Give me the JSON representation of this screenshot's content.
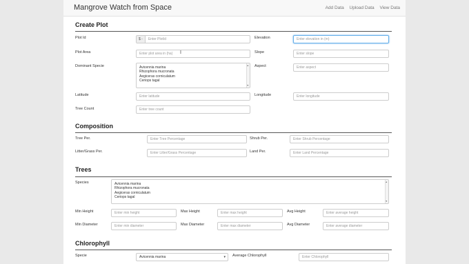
{
  "navbar": {
    "title": "Mangrove Watch from Space",
    "links": [
      "Add Data",
      "Upload Data",
      "View Data"
    ]
  },
  "create_plot": {
    "heading": "Create Plot",
    "plot_id": {
      "label": "Plot Id",
      "addon": "$ -",
      "placeholder": "Enter PlotId"
    },
    "elevation": {
      "label": "Elevation",
      "placeholder": "Enter elevation in (m)"
    },
    "plot_area": {
      "label": "Plot Area",
      "placeholder": "Enter plot area in (ha)"
    },
    "slope": {
      "label": "Slope",
      "placeholder": "Enter slope"
    },
    "dominant_specie": {
      "label": "Dominant Specie",
      "options": [
        "Avicennia marina",
        "Rhizophora mucronata",
        "Aegiceras corniculatum",
        "Ceriops tagal"
      ]
    },
    "aspect": {
      "label": "Aspect",
      "placeholder": "Enter aspect"
    },
    "latitude": {
      "label": "Latitude",
      "placeholder": "Enter latitude"
    },
    "longitude": {
      "label": "Longitude",
      "placeholder": "Enter longitude"
    },
    "tree_count": {
      "label": "Tree Count",
      "placeholder": "Enter tree count"
    }
  },
  "composition": {
    "heading": "Composition",
    "tree_per": {
      "label": "Tree Per.",
      "placeholder": "Enter Tree Percentage"
    },
    "shrub_per": {
      "label": "Shrub Per.",
      "placeholder": "Enter Shrub Percentage"
    },
    "litter_grass_per": {
      "label": "Litter/Grass Per.",
      "placeholder": "Enter Litter/Grass Percentage"
    },
    "land_per": {
      "label": "Land Per.",
      "placeholder": "Enter Land Percentage"
    }
  },
  "trees": {
    "heading": "Trees",
    "species": {
      "label": "Species",
      "options": [
        "Avicennia marina",
        "Rhizophora mucronata",
        "Aegiceras corniculatum",
        "Ceriops tagal"
      ]
    },
    "min_height": {
      "label": "Min Height",
      "placeholder": "Enter min height"
    },
    "max_height": {
      "label": "Max Height",
      "placeholder": "Enter max height"
    },
    "avg_height": {
      "label": "Avg Height",
      "placeholder": "Enter average height"
    },
    "min_diameter": {
      "label": "Min Diameter",
      "placeholder": "Enter min diameter"
    },
    "max_diameter": {
      "label": "Max Diameter",
      "placeholder": "Enter max diameter"
    },
    "avg_diameter": {
      "label": "Avg Diameter",
      "placeholder": "Enter average diameter"
    }
  },
  "chlorophyll": {
    "heading": "Chlorophyll",
    "specie": {
      "label": "Specie",
      "value": "Avicennia marina"
    },
    "average": {
      "label": "Average Chlorophyll",
      "placeholder": "Enter Chlorophyll"
    }
  },
  "colors": {
    "focus_border": "#66afe9",
    "navbar_bg": "#f8f8f8",
    "gutter": "#e9e9e9"
  }
}
